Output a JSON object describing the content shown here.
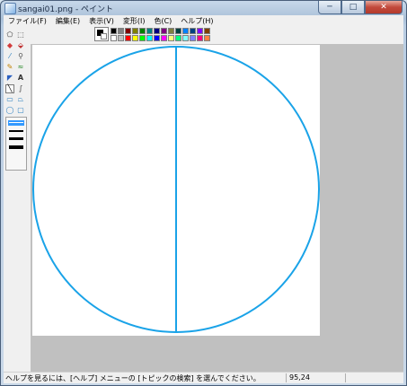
{
  "window": {
    "title": "sangai01.png - ペイント",
    "controls": {
      "minimize": "─",
      "maximize": "□",
      "close": "✕"
    }
  },
  "menubar": {
    "items": [
      {
        "label": "ファイル(F)"
      },
      {
        "label": "編集(E)"
      },
      {
        "label": "表示(V)"
      },
      {
        "label": "変形(I)"
      },
      {
        "label": "色(C)"
      },
      {
        "label": "ヘルプ(H)"
      }
    ]
  },
  "toolbox": {
    "tools": [
      {
        "name": "free-select-icon",
        "glyph": "⬠"
      },
      {
        "name": "rect-select-icon",
        "glyph": "⬚"
      },
      {
        "name": "eraser-icon",
        "glyph": "◆"
      },
      {
        "name": "fill-bucket-icon",
        "glyph": "⬙"
      },
      {
        "name": "eyedropper-icon",
        "glyph": "⁄"
      },
      {
        "name": "magnifier-icon",
        "glyph": "⚲"
      },
      {
        "name": "pencil-icon",
        "glyph": "✎"
      },
      {
        "name": "brush-icon",
        "glyph": "≈"
      },
      {
        "name": "airbrush-icon",
        "glyph": "◤"
      },
      {
        "name": "text-icon",
        "glyph": "A"
      },
      {
        "name": "line-icon",
        "glyph": "╲"
      },
      {
        "name": "curve-icon",
        "glyph": "∫"
      },
      {
        "name": "rectangle-icon",
        "glyph": "▭"
      },
      {
        "name": "polygon-icon",
        "glyph": "⏢"
      },
      {
        "name": "ellipse-icon",
        "glyph": "◯"
      },
      {
        "name": "rounded-rect-icon",
        "glyph": "▢"
      }
    ],
    "selected_tool": "line-icon"
  },
  "palette": {
    "foreground": "#000000",
    "background": "#ffffff",
    "row1": [
      "#000000",
      "#808080",
      "#800000",
      "#808000",
      "#008000",
      "#008080",
      "#000080",
      "#800080",
      "#808040",
      "#004040",
      "#0080ff",
      "#004080",
      "#8000ff",
      "#804000"
    ],
    "row2": [
      "#ffffff",
      "#c0c0c0",
      "#ff0000",
      "#ffff00",
      "#00ff00",
      "#00ffff",
      "#0000ff",
      "#ff00ff",
      "#ffff80",
      "#00ff80",
      "#80ffff",
      "#8080ff",
      "#ff0080",
      "#ff8040"
    ]
  },
  "drawing": {
    "stroke_color": "#1aa3e8",
    "canvas_color": "#ffffff",
    "workspace_color": "#c0c0c0"
  },
  "statusbar": {
    "help_text": "ヘルプを見るには、[ヘルプ] メニューの [トピックの検索] を選んでください。",
    "coords": "95,24"
  }
}
